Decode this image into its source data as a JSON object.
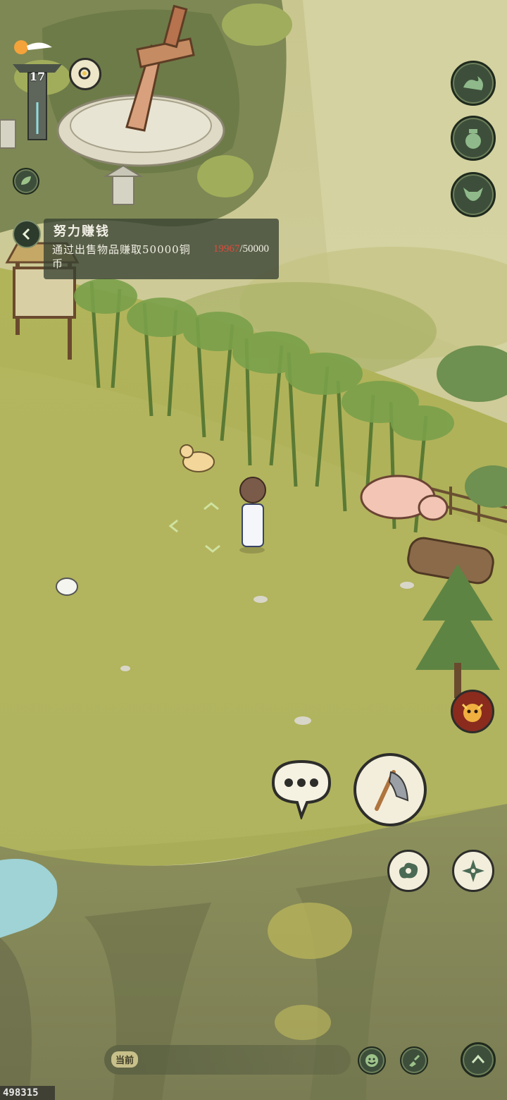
{
  "hud": {
    "level": "17"
  },
  "quest": {
    "title": "努力赚钱",
    "description": "通过出售物品赚取50000铜币",
    "progress_current": "19967",
    "progress_total": "/50000"
  },
  "chat": {
    "tag": "当前"
  },
  "footer": {
    "id": "498315"
  },
  "colors": {
    "panel_bg": "#3a4634",
    "progress_current": "#e04a3c",
    "button_bg": "#3d4f3b",
    "grass": "#b4b75f"
  },
  "icons": {
    "right_menu": [
      "wave-icon",
      "gourd-icon",
      "ox-head-icon"
    ],
    "actions": [
      "speech-bubble-icon",
      "axe-icon",
      "cloud-swirl-icon",
      "shuriken-icon",
      "smiley-icon",
      "brush-icon",
      "chevron-up-icon",
      "demon-face-icon"
    ]
  }
}
